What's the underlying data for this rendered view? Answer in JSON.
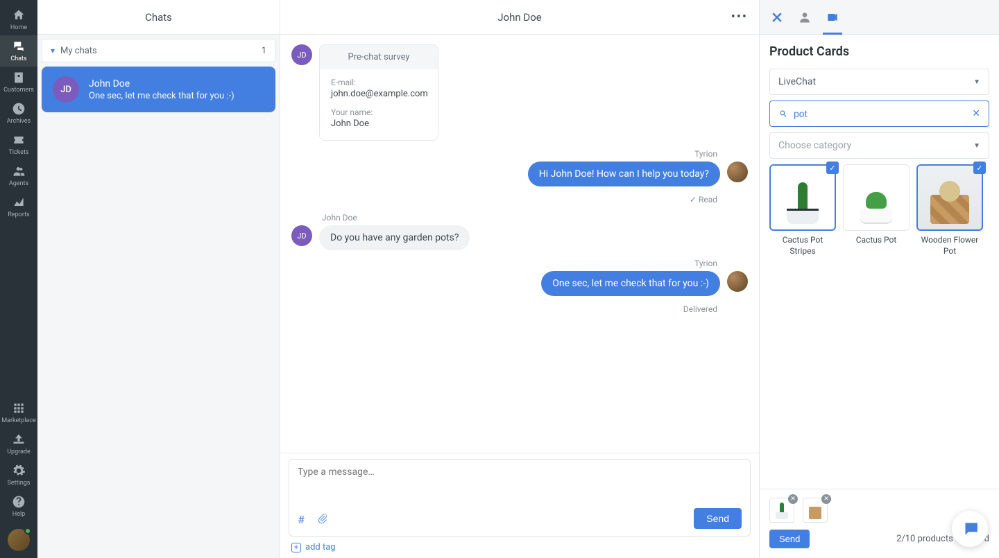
{
  "nav": {
    "items": [
      {
        "label": "Home"
      },
      {
        "label": "Chats"
      },
      {
        "label": "Customers"
      },
      {
        "label": "Archives"
      },
      {
        "label": "Tickets"
      },
      {
        "label": "Agents"
      },
      {
        "label": "Reports"
      }
    ],
    "bottom": [
      {
        "label": "Marketplace"
      },
      {
        "label": "Upgrade"
      },
      {
        "label": "Settings"
      },
      {
        "label": "Help"
      }
    ]
  },
  "chat_list": {
    "title": "Chats",
    "section_label": "My chats",
    "section_count": "1",
    "active": {
      "initials": "JD",
      "name": "John Doe",
      "preview": "One sec, let me check that for you :-)"
    }
  },
  "convo": {
    "title": "John Doe",
    "visitor_initials": "JD",
    "survey": {
      "title": "Pre-chat survey",
      "email_label": "E-mail:",
      "email_value": "john.doe@example.com",
      "name_label": "Your name:",
      "name_value": "John Doe"
    },
    "agent_name_1": "Tyrion",
    "agent_msg_1": "Hi John Doe! How can I help you today?",
    "status_read": "Read",
    "visitor_name": "John Doe",
    "visitor_msg": "Do you have any garden pots?",
    "agent_name_2": "Tyrion",
    "agent_msg_2": "One sec, let me check that for you :-)",
    "status_delivered": "Delivered",
    "compose_placeholder": "Type a message…",
    "send_label": "Send",
    "add_tag_label": "add tag"
  },
  "panel": {
    "title": "Product Cards",
    "store_select": "LiveChat",
    "search_value": "pot",
    "category_placeholder": "Choose category",
    "products": [
      {
        "name": "Cactus Pot Stripes"
      },
      {
        "name": "Cactus Pot"
      },
      {
        "name": "Wooden Flower Pot"
      }
    ],
    "footer_send": "Send",
    "selected_label": "2/10 products selected"
  }
}
